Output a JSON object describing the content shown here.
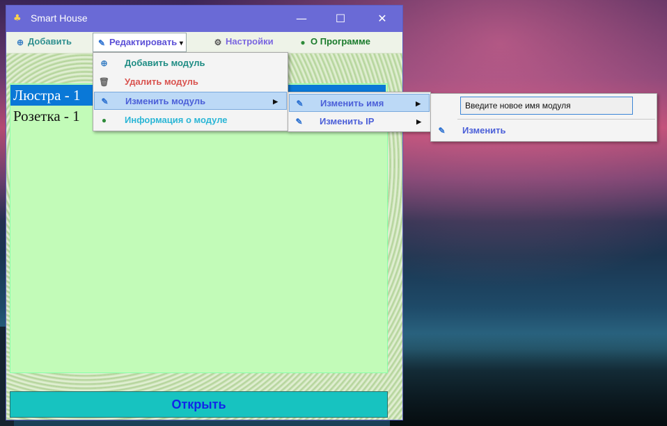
{
  "window": {
    "title": "Smart House",
    "minimize": "—",
    "maximize": "☐",
    "close": "✕"
  },
  "menubar": {
    "add": "Добавить",
    "edit": "Редактировать",
    "edit_arrow": "▾",
    "settings": "Настройки",
    "about": "О Программе"
  },
  "edit_menu": {
    "items": [
      {
        "label": "Добавить модуль",
        "icon": "add-circle-icon",
        "color": "#1f8c84"
      },
      {
        "label": "Удалить модуль",
        "icon": "trash-icon",
        "color": "#d9534f"
      },
      {
        "label": "Изменить модуль",
        "icon": "edit-note-icon",
        "color": "#4b5fd8",
        "arrow": "▶"
      },
      {
        "label": "Информация о модуле",
        "icon": "info-globe-icon",
        "color": "#2bb6d6"
      }
    ]
  },
  "modify_submenu": {
    "items": [
      {
        "label": "Изменить имя",
        "icon": "edit-note-icon",
        "arrow": "▶"
      },
      {
        "label": "Изменить IP",
        "icon": "edit-note-icon",
        "arrow": "▶"
      }
    ]
  },
  "rename_submenu": {
    "input_value": "Введите новое имя модуля",
    "apply": "Изменить"
  },
  "list": {
    "rows": [
      "Люстра - 1",
      "Розетка - 1"
    ]
  },
  "open_button": "Открыть"
}
